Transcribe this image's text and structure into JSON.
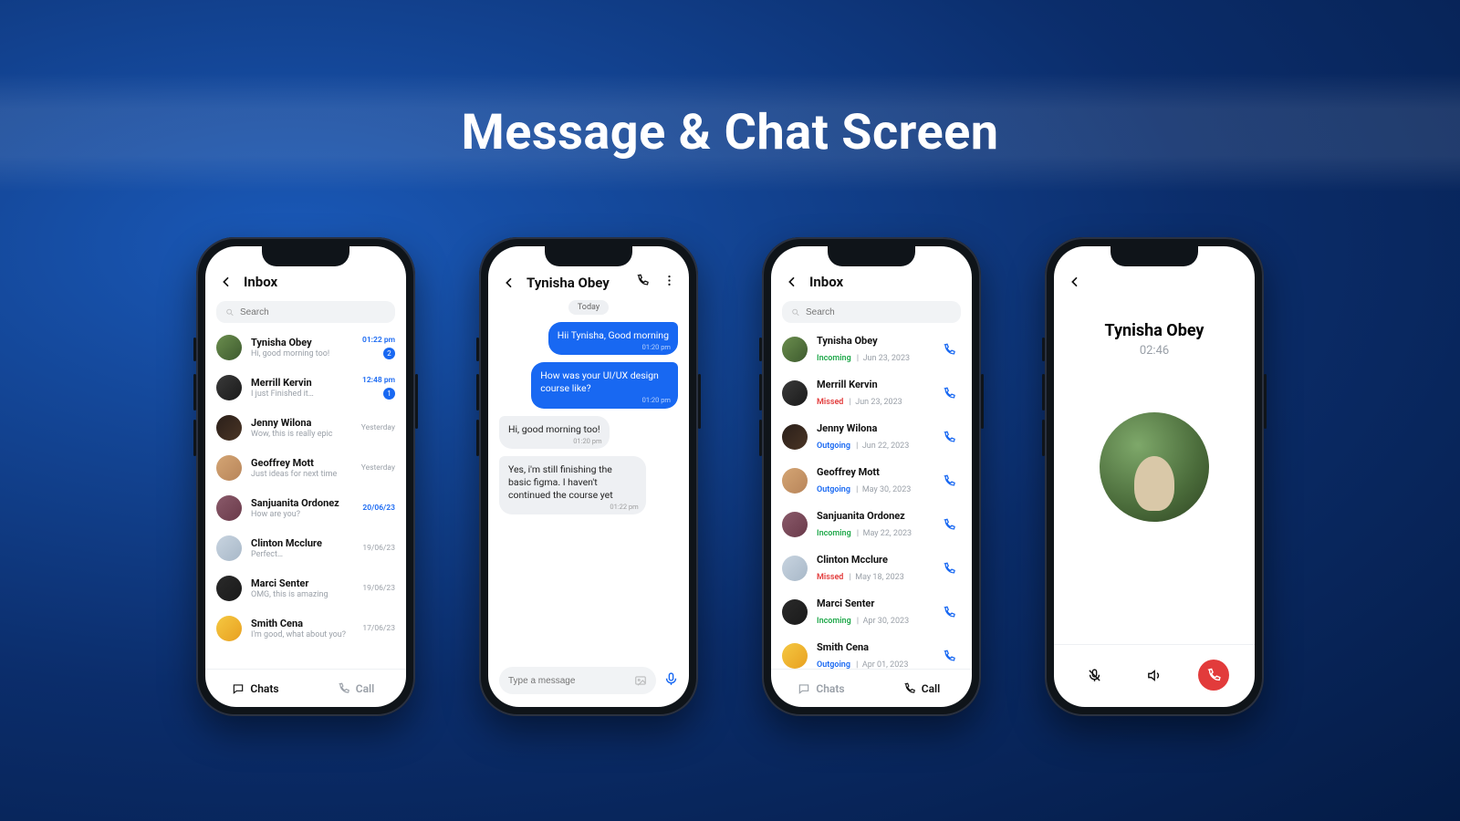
{
  "banner_title": "Message & Chat Screen",
  "chats_screen": {
    "title": "Inbox",
    "search_placeholder": "Search",
    "tabs": {
      "chats": "Chats",
      "call": "Call"
    },
    "items": [
      {
        "name": "Tynisha Obey",
        "preview": "Hi, good morning too!",
        "time": "01:22 pm",
        "blue": true,
        "badge": "2"
      },
      {
        "name": "Merrill Kervin",
        "preview": "I just Finished it…",
        "time": "12:48 pm",
        "blue": true,
        "badge": "1"
      },
      {
        "name": "Jenny Wilona",
        "preview": "Wow, this is really epic",
        "time": "Yesterday"
      },
      {
        "name": "Geoffrey Mott",
        "preview": "Just ideas for next time",
        "time": "Yesterday"
      },
      {
        "name": "Sanjuanita Ordonez",
        "preview": "How are you?",
        "time": "20/06/23",
        "blue": true
      },
      {
        "name": "Clinton Mcclure",
        "preview": "Perfect…",
        "time": "19/06/23"
      },
      {
        "name": "Marci Senter",
        "preview": "OMG, this is amazing",
        "time": "19/06/23"
      },
      {
        "name": "Smith Cena",
        "preview": "I'm good, what about you?",
        "time": "17/06/23"
      }
    ]
  },
  "chat_screen": {
    "title": "Tynisha Obey",
    "day_label": "Today",
    "composer_placeholder": "Type a message",
    "messages": [
      {
        "dir": "out",
        "text": "Hii Tynisha, Good morning",
        "time": "01:20 pm"
      },
      {
        "dir": "out",
        "text": "How was your UI/UX design course like?",
        "time": "01:20 pm"
      },
      {
        "dir": "in",
        "text": "Hi, good morning too!",
        "time": "01:20 pm"
      },
      {
        "dir": "in",
        "text": "Yes, i'm still finishing the basic figma. I haven't continued the course yet",
        "time": "01:22 pm"
      }
    ]
  },
  "calls_screen": {
    "title": "Inbox",
    "search_placeholder": "Search",
    "tabs": {
      "chats": "Chats",
      "call": "Call"
    },
    "items": [
      {
        "name": "Tynisha Obey",
        "status": "Incoming",
        "status_cls": "cs-in",
        "date": "Jun 23, 2023"
      },
      {
        "name": "Merrill Kervin",
        "status": "Missed",
        "status_cls": "cs-miss",
        "date": "Jun 23, 2023"
      },
      {
        "name": "Jenny Wilona",
        "status": "Outgoing",
        "status_cls": "cs-out",
        "date": "Jun 22, 2023"
      },
      {
        "name": "Geoffrey Mott",
        "status": "Outgoing",
        "status_cls": "cs-out",
        "date": "May 30, 2023"
      },
      {
        "name": "Sanjuanita Ordonez",
        "status": "Incoming",
        "status_cls": "cs-in",
        "date": "May 22, 2023"
      },
      {
        "name": "Clinton Mcclure",
        "status": "Missed",
        "status_cls": "cs-miss",
        "date": "May 18, 2023"
      },
      {
        "name": "Marci Senter",
        "status": "Incoming",
        "status_cls": "cs-in",
        "date": "Apr 30, 2023"
      },
      {
        "name": "Smith Cena",
        "status": "Outgoing",
        "status_cls": "cs-out",
        "date": "Apr 01, 2023"
      }
    ]
  },
  "active_call": {
    "name": "Tynisha Obey",
    "timer": "02:46"
  }
}
